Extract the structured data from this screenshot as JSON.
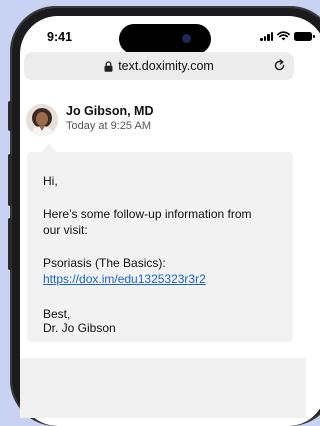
{
  "status_bar": {
    "time": "9:41"
  },
  "browser": {
    "url": "text.doximity.com"
  },
  "message": {
    "sender_name": "Jo Gibson, MD",
    "sent_time": "Today at 9:25 AM",
    "greeting": "Hi,",
    "body_line1": "Here’s some follow-up information from",
    "body_line2": "our visit:",
    "resource_title": "Psoriasis (The Basics):",
    "resource_link": "https://dox.im/edu1325323r3r2",
    "closing": "Best,",
    "signature": "Dr. Jo Gibson"
  },
  "colors": {
    "background": "#c9d2f2",
    "link": "#1a64c8",
    "bubble": "#f2f2f3"
  }
}
